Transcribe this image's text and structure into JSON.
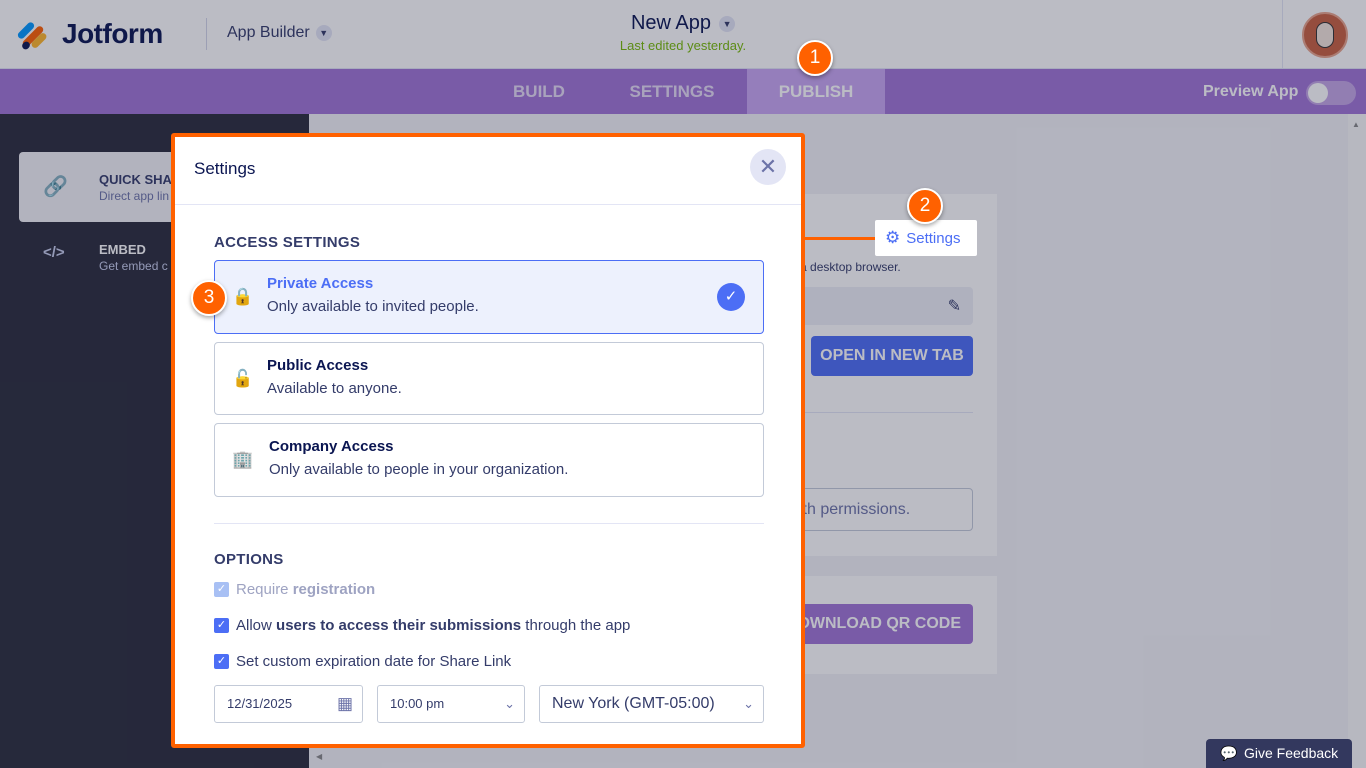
{
  "header": {
    "logo_text": "Jotform",
    "app_builder_label": "App Builder",
    "app_title": "New App",
    "last_edited": "Last edited yesterday."
  },
  "nav": {
    "tabs": [
      {
        "label": "BUILD",
        "active": false
      },
      {
        "label": "SETTINGS",
        "active": false
      },
      {
        "label": "PUBLISH",
        "active": true
      }
    ],
    "preview_label": "Preview App",
    "preview_enabled": false
  },
  "sidebar": {
    "items": [
      {
        "title": "QUICK SHA",
        "subtitle": "Direct app lin",
        "icon": "link-icon",
        "selected": true
      },
      {
        "title": "EMBED",
        "subtitle": "Get embed c",
        "icon": "code-icon",
        "selected": false
      }
    ]
  },
  "background": {
    "settings_button": "Settings",
    "desktop_hint": "n a desktop browser.",
    "open_tab_button": "OPEN IN NEW TAB",
    "permissions_hint": "ith permissions.",
    "qr_button": "OWNLOAD QR CODE"
  },
  "callouts": [
    "1",
    "2",
    "3"
  ],
  "modal": {
    "title": "Settings",
    "access_title": "ACCESS SETTINGS",
    "access_options": [
      {
        "title": "Private Access",
        "subtitle": "Only available to invited people.",
        "icon": "lock-icon",
        "selected": true
      },
      {
        "title": "Public Access",
        "subtitle": "Available to anyone.",
        "icon": "unlock-icon",
        "selected": false
      },
      {
        "title": "Company Access",
        "subtitle": "Only available to people in your organization.",
        "icon": "building-icon",
        "selected": false
      }
    ],
    "options_title": "OPTIONS",
    "options": {
      "require_pre": "Require ",
      "require_bold": "registration",
      "allow_pre": "Allow ",
      "allow_bold": "users to access their submissions",
      "allow_post": " through the app",
      "expiry_label": "Set custom expiration date for Share Link"
    },
    "date_value": "12/31/2025",
    "time_value": "10:00 pm",
    "timezone_value": "New York (GMT-05:00)"
  },
  "feedback_label": "Give Feedback",
  "colors": {
    "accent": "#4c6ef5",
    "publish_purple": "#a174d6",
    "highlight_orange": "#ff6100"
  }
}
